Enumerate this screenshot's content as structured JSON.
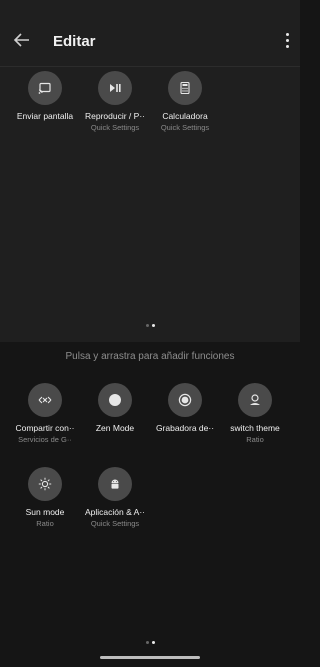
{
  "header": {
    "title": "Editar",
    "back_icon": "arrow-left-icon",
    "more_icon": "more-vert-icon"
  },
  "active_tiles": [
    {
      "label": "Enviar pantalla",
      "sub": "",
      "icon": "cast-icon"
    },
    {
      "label": "Reproducir / P··",
      "sub": "Quick Settings",
      "icon": "play-pause-icon"
    },
    {
      "label": "Calculadora",
      "sub": "Quick Settings",
      "icon": "calculator-icon"
    }
  ],
  "hint": "Pulsa y arrastra para añadir funciones",
  "available_tiles": [
    {
      "label": "Compartir con··",
      "sub": "Servicios de G··",
      "icon": "nearby-share-icon"
    },
    {
      "label": "Zen Mode",
      "sub": "",
      "icon": "zen-mode-icon"
    },
    {
      "label": "Grabadora de··",
      "sub": "",
      "icon": "screen-record-icon"
    },
    {
      "label": "switch theme",
      "sub": "Ratio",
      "icon": "theme-icon"
    },
    {
      "label": "Sun mode",
      "sub": "Ratio",
      "icon": "sun-icon"
    },
    {
      "label": "Aplicación & A··",
      "sub": "Quick Settings",
      "icon": "android-icon"
    }
  ],
  "pager": {
    "pages": 2,
    "current": 2
  }
}
